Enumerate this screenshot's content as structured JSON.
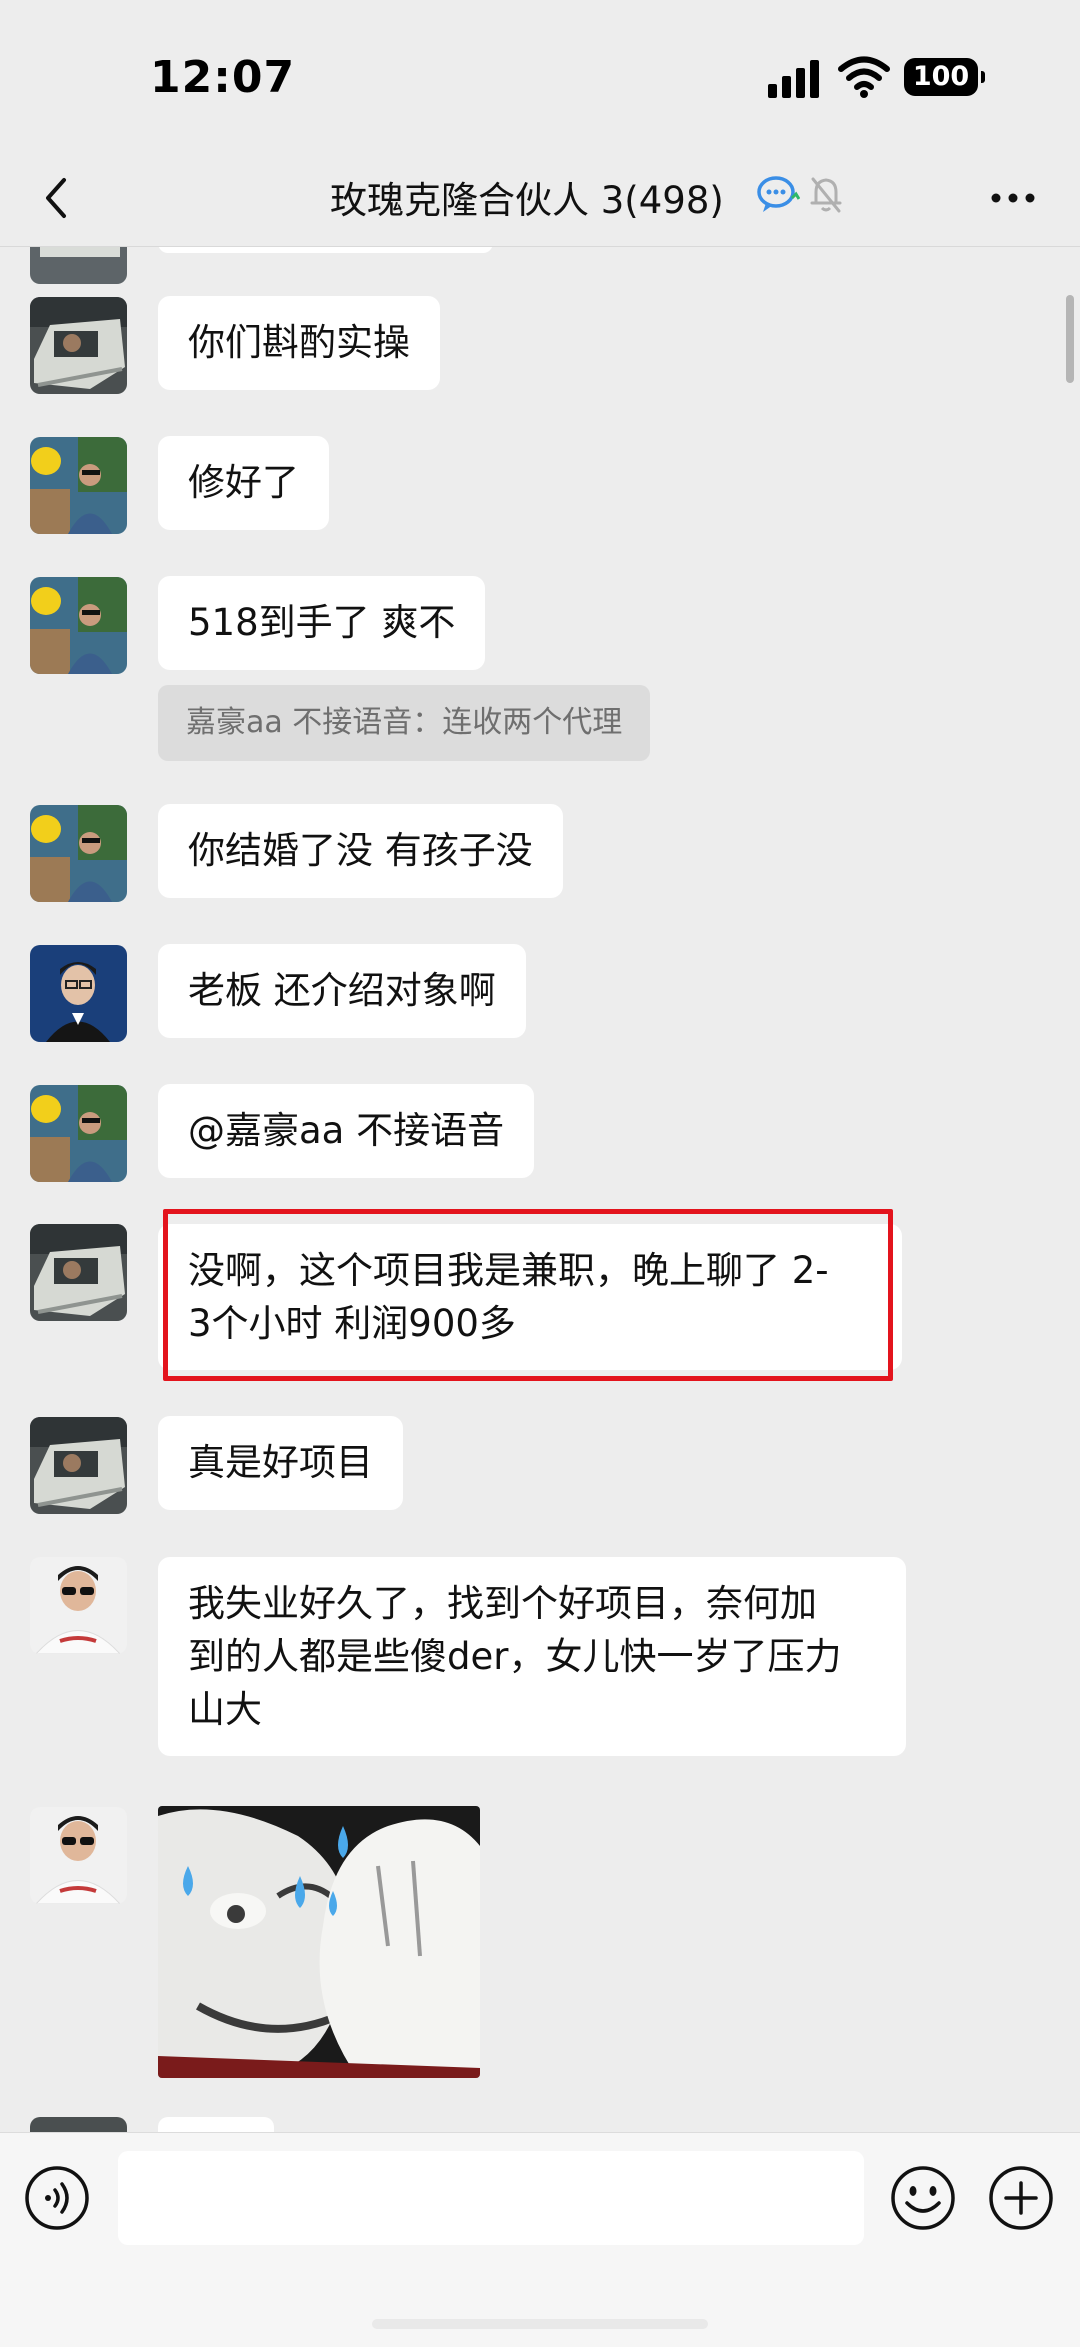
{
  "status_bar": {
    "time": "12:07",
    "battery": "100"
  },
  "header": {
    "title": "玫瑰克隆合伙人 3(498)",
    "icons": [
      "back-chevron-icon",
      "group-chat-icon",
      "mute-bell-icon",
      "more-dots-icon"
    ]
  },
  "messages": [
    {
      "type": "text",
      "sender": "car-avatar",
      "text": "你们斟酌实操"
    },
    {
      "type": "text",
      "sender": "toy-avatar",
      "text": "修好了"
    },
    {
      "type": "text",
      "sender": "toy-avatar",
      "text": "518到手了 爽不"
    },
    {
      "type": "system",
      "text": "嘉豪aa 不接语音：连收两个代理"
    },
    {
      "type": "text",
      "sender": "toy-avatar",
      "text": "你结婚了没 有孩子没"
    },
    {
      "type": "text",
      "sender": "suit-avatar",
      "text": "老板 还介绍对象啊"
    },
    {
      "type": "text",
      "sender": "toy-avatar",
      "text": "@嘉豪aa 不接语音"
    },
    {
      "type": "text",
      "sender": "car-avatar",
      "highlighted": true,
      "lines": [
        "没啊，这个项目我是兼职，晚上聊了 2-",
        "3个小时 利润900多"
      ]
    },
    {
      "type": "text",
      "sender": "car-avatar",
      "text": "真是好项目"
    },
    {
      "type": "text",
      "sender": "sunglasses-avatar",
      "lines": [
        "我失业好久了，找到个好项目，奈何加",
        "到的人都是些傻der，女儿快一岁了压力",
        "山大"
      ]
    },
    {
      "type": "sticker",
      "sender": "sunglasses-avatar",
      "description": "sweating-meme-sticker"
    }
  ],
  "input_bar": {
    "placeholder": "",
    "icons": [
      "voice-icon",
      "emoji-icon",
      "plus-icon"
    ]
  },
  "colors": {
    "background": "#ededed",
    "bubble": "#ffffff",
    "highlight": "#e3141d",
    "accent": "#3a8ee6"
  }
}
